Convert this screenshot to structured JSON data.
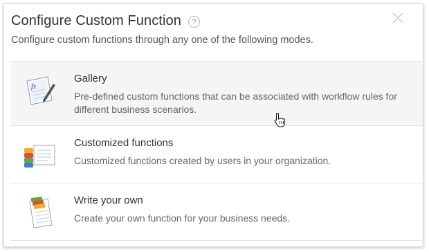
{
  "dialog": {
    "title": "Configure Custom Function",
    "help_glyph": "?",
    "subtitle": "Configure custom functions through any one of the following modes."
  },
  "options": [
    {
      "icon": "gallery-fx-document-icon",
      "title": "Gallery",
      "description": "Pre-defined custom functions that can be associated with workflow rules for different business scenarios."
    },
    {
      "icon": "customized-functions-stack-icon",
      "title": "Customized functions",
      "description": "Customized functions created by users in your organization."
    },
    {
      "icon": "write-your-own-notepad-icon",
      "title": "Write your own",
      "description": "Create your own function for your business needs."
    }
  ],
  "colors": {
    "hover_row": "#f5f5f5",
    "border": "#e2e2e2",
    "text": "#333333",
    "muted": "#666666"
  }
}
